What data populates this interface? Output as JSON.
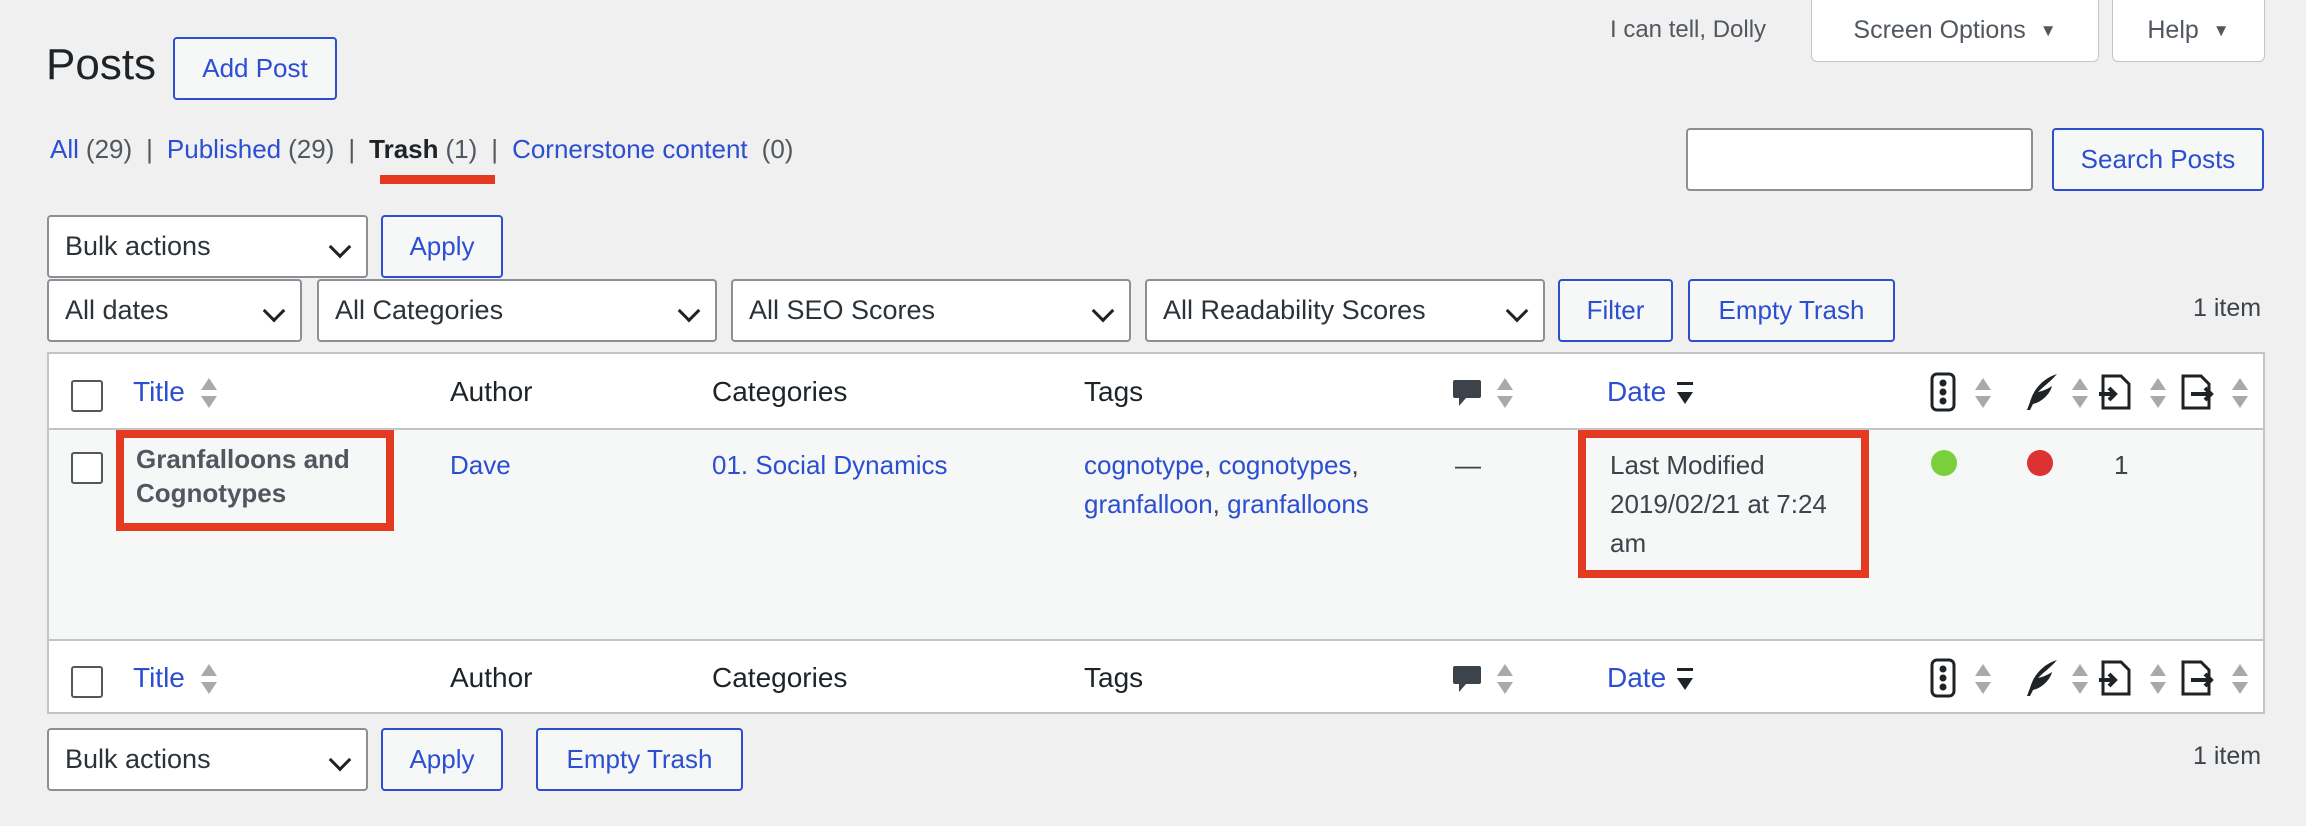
{
  "top_right": {
    "dolly_text": "I can tell, Dolly",
    "screen_options_label": "Screen Options",
    "help_label": "Help"
  },
  "header": {
    "title": "Posts",
    "add_post_label": "Add Post"
  },
  "views": {
    "all_label": "All",
    "all_count": "(29)",
    "published_label": "Published",
    "published_count": "(29)",
    "trash_label": "Trash",
    "trash_count": "(1)",
    "cornerstone_label": "Cornerstone content",
    "cornerstone_count": "(0)",
    "separator": "|"
  },
  "search": {
    "value": "",
    "button_label": "Search Posts"
  },
  "tablenav_top": {
    "bulk_actions": "Bulk actions",
    "apply_label": "Apply",
    "dates_filter": "All dates",
    "categories_filter": "All Categories",
    "seo_filter": "All SEO Scores",
    "readability_filter": "All Readability Scores",
    "filter_label": "Filter",
    "empty_trash_label": "Empty Trash",
    "items_count": "1 item"
  },
  "table": {
    "columns": {
      "title": "Title",
      "author": "Author",
      "categories": "Categories",
      "tags": "Tags",
      "date": "Date"
    },
    "icons": [
      "comments-icon",
      "seo-traffic-light-icon",
      "readability-feather-icon",
      "outgoing-links-icon",
      "incoming-links-icon"
    ],
    "rows": [
      {
        "title_line1": "Granfalloons and",
        "title_line2": "Cognotypes",
        "author": "Dave",
        "category": "01. Social Dynamics",
        "tags": [
          "cognotype",
          "cognotypes",
          "granfalloon",
          "granfalloons"
        ],
        "tag_separator": ",",
        "comments": "—",
        "date_line1": "Last Modified",
        "date_line2": "2019/02/21 at 7:24",
        "date_line3": "am",
        "seo_status_color": "#7ad03a",
        "readability_status_color": "#dc3232",
        "links_count": "1"
      }
    ]
  },
  "tablenav_bottom": {
    "bulk_actions": "Bulk actions",
    "apply_label": "Apply",
    "empty_trash_label": "Empty Trash",
    "items_count": "1 item"
  },
  "colors": {
    "accent": "#2b4fd0",
    "highlight": "#e53a22",
    "background": "#f0f0f1"
  }
}
